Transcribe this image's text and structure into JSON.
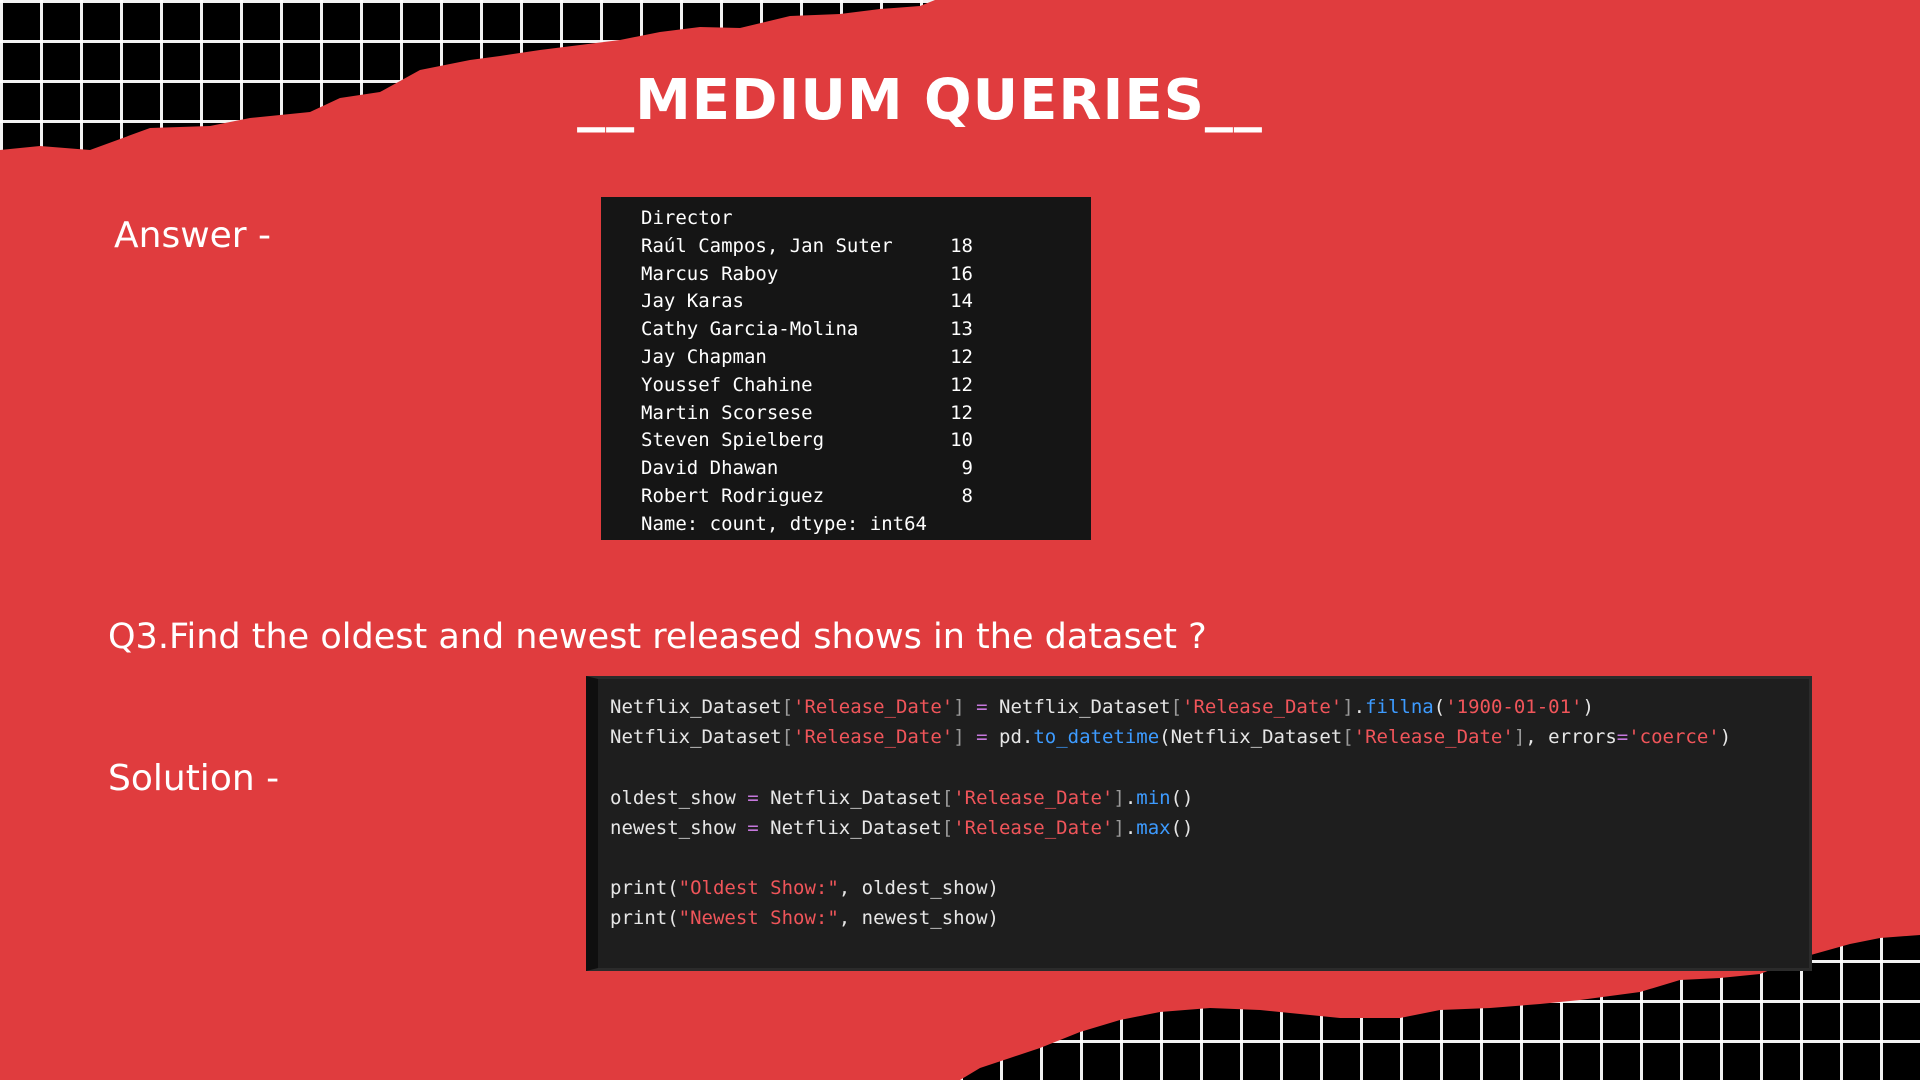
{
  "slide": {
    "title": "__MEDIUM QUERIES__",
    "answer_label": "Answer -",
    "question": "Q3.Find the oldest and newest released shows in the dataset ?",
    "solution_label": "Solution -",
    "colors": {
      "paper": "#e03c3e",
      "grid_background": "#000000",
      "grid_lines": "#ffffff",
      "terminal_bg": "#151515",
      "code_bg": "#1e1e1e",
      "string": "#f0555a",
      "function": "#3d9bff",
      "operator": "#c678dd"
    }
  },
  "output": {
    "header": "Director",
    "rows": [
      {
        "name": "Raúl Campos, Jan Suter",
        "count": "18"
      },
      {
        "name": "Marcus Raboy",
        "count": "16"
      },
      {
        "name": "Jay Karas",
        "count": "14"
      },
      {
        "name": "Cathy Garcia-Molina",
        "count": "13"
      },
      {
        "name": "Jay Chapman",
        "count": "12"
      },
      {
        "name": "Youssef Chahine",
        "count": "12"
      },
      {
        "name": "Martin Scorsese",
        "count": "12"
      },
      {
        "name": "Steven Spielberg",
        "count": "10"
      },
      {
        "name": "David Dhawan",
        "count": "9"
      },
      {
        "name": "Robert Rodriguez",
        "count": "8"
      }
    ],
    "footer": "Name: count, dtype: int64"
  },
  "code": {
    "lines": [
      [
        {
          "t": "Netflix_Dataset",
          "c": "p"
        },
        {
          "t": "[",
          "c": "br"
        },
        {
          "t": "'Release_Date'",
          "c": "str"
        },
        {
          "t": "]",
          "c": "br"
        },
        {
          "t": " ",
          "c": "p"
        },
        {
          "t": "=",
          "c": "op"
        },
        {
          "t": " Netflix_Dataset",
          "c": "p"
        },
        {
          "t": "[",
          "c": "br"
        },
        {
          "t": "'Release_Date'",
          "c": "str"
        },
        {
          "t": "]",
          "c": "br"
        },
        {
          "t": ".",
          "c": "p"
        },
        {
          "t": "fillna",
          "c": "fn"
        },
        {
          "t": "(",
          "c": "p"
        },
        {
          "t": "'1900-01-01'",
          "c": "str"
        },
        {
          "t": ")",
          "c": "p"
        }
      ],
      [
        {
          "t": "Netflix_Dataset",
          "c": "p"
        },
        {
          "t": "[",
          "c": "br"
        },
        {
          "t": "'Release_Date'",
          "c": "str"
        },
        {
          "t": "]",
          "c": "br"
        },
        {
          "t": " ",
          "c": "p"
        },
        {
          "t": "=",
          "c": "op"
        },
        {
          "t": " pd.",
          "c": "p"
        },
        {
          "t": "to_datetime",
          "c": "fn"
        },
        {
          "t": "(Netflix_Dataset",
          "c": "p"
        },
        {
          "t": "[",
          "c": "br"
        },
        {
          "t": "'Release_Date'",
          "c": "str"
        },
        {
          "t": "]",
          "c": "br"
        },
        {
          "t": ", errors",
          "c": "p"
        },
        {
          "t": "=",
          "c": "op"
        },
        {
          "t": "'coerce'",
          "c": "str"
        },
        {
          "t": ")",
          "c": "p"
        }
      ],
      [],
      [
        {
          "t": "oldest_show ",
          "c": "p"
        },
        {
          "t": "=",
          "c": "op"
        },
        {
          "t": " Netflix_Dataset",
          "c": "p"
        },
        {
          "t": "[",
          "c": "br"
        },
        {
          "t": "'Release_Date'",
          "c": "str"
        },
        {
          "t": "]",
          "c": "br"
        },
        {
          "t": ".",
          "c": "p"
        },
        {
          "t": "min",
          "c": "fn"
        },
        {
          "t": "()",
          "c": "p"
        }
      ],
      [
        {
          "t": "newest_show ",
          "c": "p"
        },
        {
          "t": "=",
          "c": "op"
        },
        {
          "t": " Netflix_Dataset",
          "c": "p"
        },
        {
          "t": "[",
          "c": "br"
        },
        {
          "t": "'Release_Date'",
          "c": "str"
        },
        {
          "t": "]",
          "c": "br"
        },
        {
          "t": ".",
          "c": "p"
        },
        {
          "t": "max",
          "c": "fn"
        },
        {
          "t": "()",
          "c": "p"
        }
      ],
      [],
      [
        {
          "t": "print(",
          "c": "p"
        },
        {
          "t": "\"Oldest Show:\"",
          "c": "str"
        },
        {
          "t": ", oldest_show)",
          "c": "p"
        }
      ],
      [
        {
          "t": "print(",
          "c": "p"
        },
        {
          "t": "\"Newest Show:\"",
          "c": "str"
        },
        {
          "t": ", newest_show)",
          "c": "p"
        }
      ]
    ]
  }
}
